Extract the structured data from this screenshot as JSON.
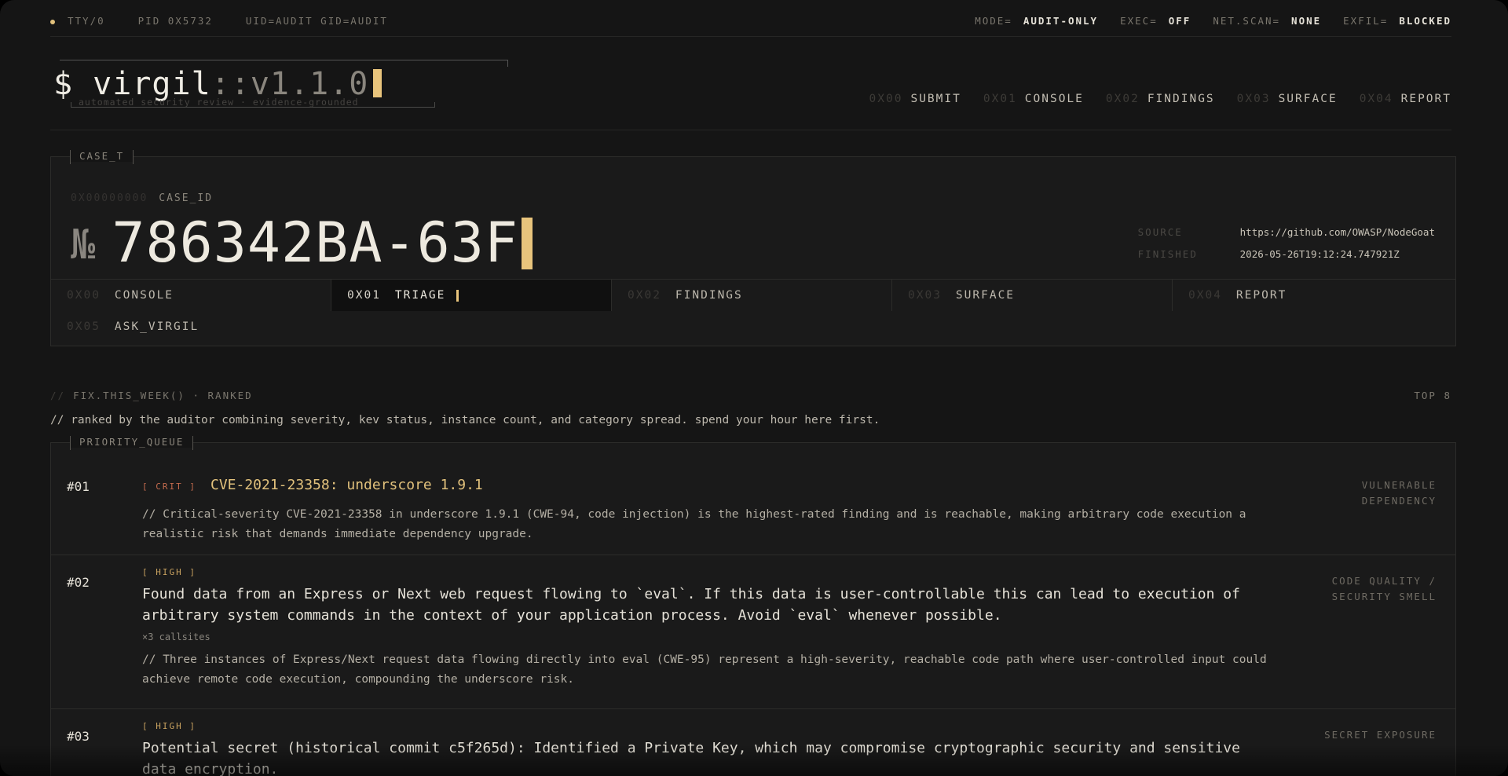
{
  "status_bar": {
    "tty": "TTY/0",
    "pid": "PID 0X5732",
    "ids": "UID=AUDIT GID=AUDIT",
    "mode_key": "MODE=",
    "mode_val": "AUDIT-ONLY",
    "exec_key": "EXEC=",
    "exec_val": "OFF",
    "netscan_key": "NET.SCAN=",
    "netscan_val": "NONE",
    "exfil_key": "EXFIL=",
    "exfil_val": "BLOCKED",
    "accent": "#e1c17c"
  },
  "brand": {
    "prompt": "$ virgil",
    "version": "::v1.1.0",
    "subtitle": "automated security review · evidence-grounded"
  },
  "top_nav": [
    {
      "num": "0X00",
      "label": "SUBMIT"
    },
    {
      "num": "0X01",
      "label": "CONSOLE"
    },
    {
      "num": "0X02",
      "label": "FINDINGS"
    },
    {
      "num": "0X03",
      "label": "SURFACE"
    },
    {
      "num": "0X04",
      "label": "REPORT"
    }
  ],
  "case": {
    "tag": "CASE_T",
    "id_addr": "0X00000000",
    "id_label": "CASE_ID",
    "no_symbol": "№",
    "case_id": "786342BA-63F",
    "source_key": "SOURCE",
    "source_val": "https://github.com/OWASP/NodeGoat",
    "finished_key": "FINISHED",
    "finished_val": "2026-05-26T19:12:24.747921Z"
  },
  "case_tabs": [
    {
      "num": "0X00",
      "label": "CONSOLE",
      "active": false
    },
    {
      "num": "0X01",
      "label": "TRIAGE",
      "active": true
    },
    {
      "num": "0X02",
      "label": "FINDINGS",
      "active": false
    },
    {
      "num": "0X03",
      "label": "SURFACE",
      "active": false
    },
    {
      "num": "0X04",
      "label": "REPORT",
      "active": false
    },
    {
      "num": "0X05",
      "label": "ASK_VIRGIL",
      "active": false
    }
  ],
  "fix": {
    "heading_prefix": "//",
    "heading": "FIX.THIS_WEEK() · RANKED",
    "top": "TOP 8",
    "note": "// ranked by the auditor combining severity, kev status, instance count, and category spread. spend your hour here first.",
    "queue_tag": "PRIORITY_QUEUE"
  },
  "items": [
    {
      "rank": "#01",
      "severity": "[ CRIT ]",
      "title": "CVE-2021-23358: underscore 1.9.1",
      "note": "// Critical-severity CVE-2021-23358 in underscore 1.9.1 (CWE-94, code injection) is the highest-rated finding and is reachable, making arbitrary code execution a realistic risk that demands immediate dependency upgrade.",
      "category": "VULNERABLE DEPENDENCY"
    },
    {
      "rank": "#02",
      "severity": "[ HIGH ]",
      "title": "Found data from an Express or Next web request flowing to `eval`. If this data is user-controllable this can lead to execution of arbitrary system commands in the context of your application process. Avoid `eval` whenever possible.",
      "callsites": "×3 callsites",
      "note": "// Three instances of Express/Next request data flowing directly into eval (CWE-95) represent a high-severity, reachable code path where user-controlled input could achieve remote code execution, compounding the underscore risk.",
      "category": "CODE QUALITY / SECURITY SMELL"
    },
    {
      "rank": "#03",
      "severity": "[ HIGH ]",
      "title": "Potential secret (historical commit c5f265d): Identified a Private Key, which may compromise cryptographic security and sensitive data encryption.",
      "category": "SECRET EXPOSURE"
    }
  ]
}
